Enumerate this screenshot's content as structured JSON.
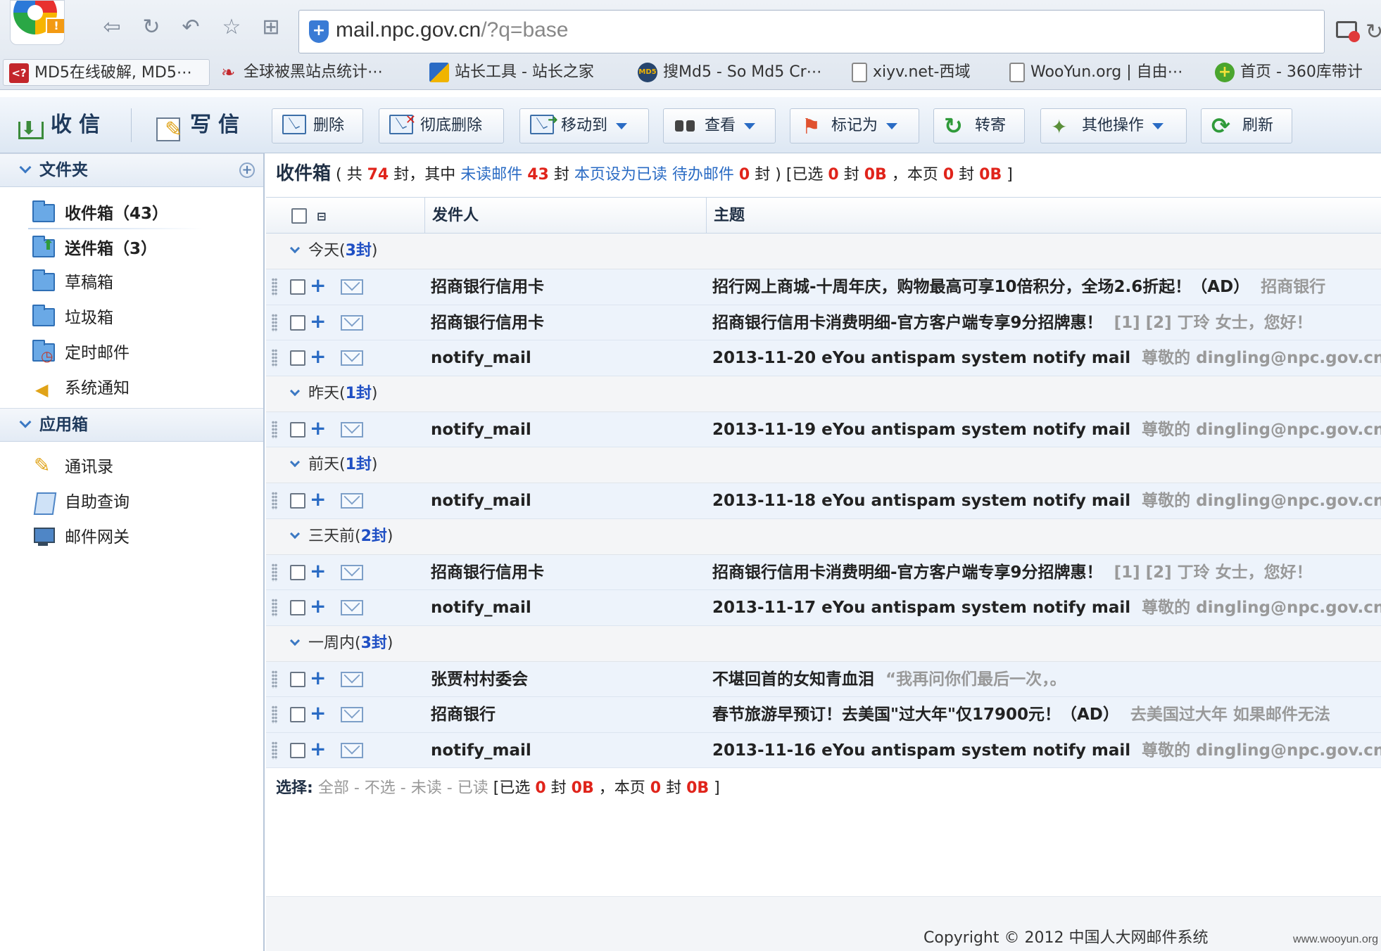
{
  "browser": {
    "url_domain": "mail.npc.gov.cn",
    "url_path": "/?q=base",
    "bookmarks": [
      {
        "label": "MD5在线破解, MD5⋯",
        "icon": "md5-icon"
      },
      {
        "label": "全球被黑站点统计⋯",
        "icon": "dragon-icon"
      },
      {
        "label": "站长工具 - 站长之家",
        "icon": "chinaz-icon"
      },
      {
        "label": "搜Md5 - So Md5 Cr⋯",
        "icon": "somd5-icon"
      },
      {
        "label": "xiyv.net-西域",
        "icon": "page-icon"
      },
      {
        "label": "WooYun.org | 自由⋯",
        "icon": "page-icon"
      },
      {
        "label": "首页 - 360库带计",
        "icon": "plus-green-icon"
      }
    ]
  },
  "toolbar": {
    "receive": "收信",
    "compose": "写信",
    "buttons": [
      {
        "label": "删除",
        "icon": "delete-envelope-icon",
        "dropdown": false
      },
      {
        "label": "彻底删除",
        "icon": "permanent-delete-icon",
        "dropdown": false
      },
      {
        "label": "移动到",
        "icon": "move-envelope-icon",
        "dropdown": true
      },
      {
        "label": "查看",
        "icon": "binoculars-icon",
        "dropdown": true
      },
      {
        "label": "标记为",
        "icon": "flag-icon",
        "dropdown": true
      },
      {
        "label": "转寄",
        "icon": "forward-icon",
        "dropdown": false
      },
      {
        "label": "其他操作",
        "icon": "other-actions-icon",
        "dropdown": true
      },
      {
        "label": "刷新",
        "icon": "refresh-icon",
        "dropdown": false
      }
    ]
  },
  "sidebar": {
    "folders_title": "文件夹",
    "folders": [
      {
        "label": "收件箱（43）",
        "bold": true
      },
      {
        "label": "送件箱（3）",
        "bold": true
      },
      {
        "label": "草稿箱",
        "bold": false
      },
      {
        "label": "垃圾箱",
        "bold": false
      },
      {
        "label": "定时邮件",
        "bold": false
      },
      {
        "label": "系统通知",
        "bold": false
      }
    ],
    "apps_title": "应用箱",
    "apps": [
      {
        "label": "通讯录"
      },
      {
        "label": "自助查询"
      },
      {
        "label": "邮件网关"
      }
    ]
  },
  "summary": {
    "title": "收件箱",
    "p1": "( 共",
    "total": "74",
    "p2": "封，其中",
    "unread_link": "未读邮件",
    "unread": "43",
    "p3": "封",
    "mark_read_link": "本页设为已读",
    "todo_link": "待办邮件",
    "todo": "0",
    "p4": "封 )",
    "p5": "[已选",
    "selected": "0",
    "p6": "封",
    "selected_size": "0B",
    "p7": "，本页",
    "page_count": "0",
    "p8": "封",
    "page_size": "0B",
    "p9": "]"
  },
  "columns": {
    "sender": "发件人",
    "subject": "主题"
  },
  "groups": [
    {
      "name": "今天",
      "count": "3封",
      "rows": [
        {
          "sender": "招商银行信用卡",
          "subject": "招行网上商城-十周年庆，购物最高可享10倍积分，全场2.6折起！（AD）",
          "preview": "招商银行"
        },
        {
          "sender": "招商银行信用卡",
          "subject": "招商银行信用卡消费明细-官方客户端专享9分招牌惠！",
          "preview": "[1] [2] 丁玲 女士，您好！"
        },
        {
          "sender": "notify_mail",
          "subject": "2013-11-20 eYou antispam system notify mail",
          "preview": "尊敬的 dingling@npc.gov.cn"
        }
      ]
    },
    {
      "name": "昨天",
      "count": "1封",
      "rows": [
        {
          "sender": "notify_mail",
          "subject": "2013-11-19 eYou antispam system notify mail",
          "preview": "尊敬的 dingling@npc.gov.cn"
        }
      ]
    },
    {
      "name": "前天",
      "count": "1封",
      "rows": [
        {
          "sender": "notify_mail",
          "subject": "2013-11-18 eYou antispam system notify mail",
          "preview": "尊敬的 dingling@npc.gov.cn"
        }
      ]
    },
    {
      "name": "三天前",
      "count": "2封",
      "rows": [
        {
          "sender": "招商银行信用卡",
          "subject": "招商银行信用卡消费明细-官方客户端专享9分招牌惠！",
          "preview": "[1] [2] 丁玲 女士，您好！"
        },
        {
          "sender": "notify_mail",
          "subject": "2013-11-17 eYou antispam system notify mail",
          "preview": "尊敬的 dingling@npc.gov.cn"
        }
      ]
    },
    {
      "name": "一周内",
      "count": "3封",
      "rows": [
        {
          "sender": "张贾村村委会",
          "subject": "不堪回首的女知青血泪",
          "preview": "“我再问你们最后一次，。"
        },
        {
          "sender": "招商银行",
          "subject": "春节旅游早预订！去美国\"过大年\"仅17900元！（AD）",
          "preview": "去美国过大年 如果邮件无法"
        },
        {
          "sender": "notify_mail",
          "subject": "2013-11-16 eYou antispam system notify mail",
          "preview": "尊敬的 dingling@npc.gov.cn"
        }
      ]
    }
  ],
  "bottom": {
    "select_label": "选择:",
    "all": "全部",
    "none": "不选",
    "unread": "未读",
    "read": "已读",
    "dash": "-",
    "p1": "[已选",
    "selected": "0",
    "p2": "封",
    "selected_size": "0B",
    "p3": "，本页",
    "page_count": "0",
    "p4": "封",
    "page_size": "0B",
    "p5": "]"
  },
  "footer": {
    "copyright": "Copyright © 2012 中国人大网邮件系统"
  },
  "watermark": "www.wooyun.org",
  "colors": {
    "accent": "#2a6bc4",
    "alert": "#e0241b",
    "row_bg": "#edf3fb"
  }
}
